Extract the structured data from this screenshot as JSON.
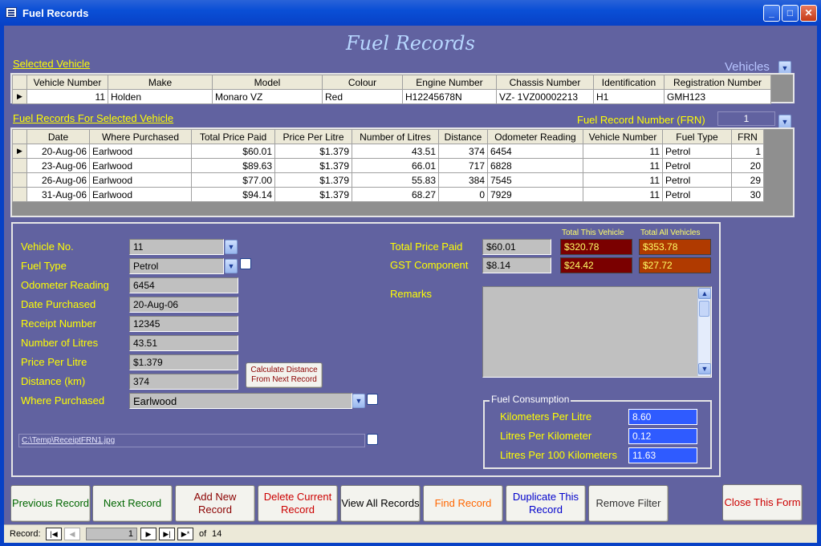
{
  "window": {
    "title": "Fuel Records"
  },
  "form": {
    "heading": "Fuel Records"
  },
  "selected_vehicle": {
    "label": "Selected Vehicle",
    "vehicles_label": "Vehicles",
    "columns": [
      "Vehicle Number",
      "Make",
      "Model",
      "Colour",
      "Engine Number",
      "Chassis Number",
      "Identification",
      "Registration Number"
    ],
    "row": [
      "11",
      "Holden",
      "Monaro VZ",
      "Red",
      "H12245678N",
      "VZ- 1VZ00002213",
      "H1",
      "GMH123"
    ]
  },
  "fuel_records": {
    "label": "Fuel Records For Selected Vehicle",
    "frn_label": "Fuel Record Number (FRN)",
    "frn_value": "1",
    "columns": [
      "Date",
      "Where Purchased",
      "Total Price Paid",
      "Price Per Litre",
      "Number of Litres",
      "Distance",
      "Odometer Reading",
      "Vehicle Number",
      "Fuel Type",
      "FRN"
    ],
    "rows": [
      [
        "20-Aug-06",
        "Earlwood",
        "$60.01",
        "$1.379",
        "43.51",
        "374",
        "6454",
        "11",
        "Petrol",
        "1"
      ],
      [
        "23-Aug-06",
        "Earlwood",
        "$89.63",
        "$1.379",
        "66.01",
        "717",
        "6828",
        "11",
        "Petrol",
        "20"
      ],
      [
        "26-Aug-06",
        "Earlwood",
        "$77.00",
        "$1.379",
        "55.83",
        "384",
        "7545",
        "11",
        "Petrol",
        "29"
      ],
      [
        "31-Aug-06",
        "Earlwood",
        "$94.14",
        "$1.379",
        "68.27",
        "0",
        "7929",
        "11",
        "Petrol",
        "30"
      ]
    ]
  },
  "detail": {
    "vehicle_no_label": "Vehicle No.",
    "vehicle_no": "11",
    "fuel_type_label": "Fuel Type",
    "fuel_type": "Petrol",
    "odometer_label": "Odometer Reading",
    "odometer": "6454",
    "date_label": "Date Purchased",
    "date": "20-Aug-06",
    "receipt_label": "Receipt Number",
    "receipt": "12345",
    "litres_label": "Number of Litres",
    "litres": "43.51",
    "ppl_label": "Price Per Litre",
    "ppl": "$1.379",
    "distance_label": "Distance (km)",
    "distance": "374",
    "where_label": "Where Purchased",
    "where": "Earlwood",
    "calc_button": "Calculate Distance From Next Record",
    "receipt_path": "C:\\Temp\\ReceiptFRN1.jpg",
    "total_price_label": "Total Price Paid",
    "total_price": "$60.01",
    "gst_label": "GST Component",
    "gst": "$8.14",
    "total_this_vehicle_label": "Total This Vehicle",
    "total_all_vehicles_label": "Total All Vehicles",
    "total_this_vehicle_price": "$320.78",
    "total_all_vehicles_price": "$353.78",
    "total_this_vehicle_gst": "$24.42",
    "total_all_vehicles_gst": "$27.72",
    "remarks_label": "Remarks",
    "remarks": ""
  },
  "consumption": {
    "legend": "Fuel Consumption",
    "kpl_label": "Kilometers Per Litre",
    "kpl": "8.60",
    "lpk_label": "Litres Per Kilometer",
    "lpk": "0.12",
    "l100_label": "Litres Per 100 Kilometers",
    "l100": "11.63"
  },
  "buttons": {
    "previous": "Previous Record",
    "next": "Next Record",
    "add": "Add New Record",
    "delete": "Delete Current Record",
    "view_all": "View All Records",
    "find": "Find Record",
    "duplicate": "Duplicate This Record",
    "remove_filter": "Remove Filter",
    "close": "Close This Form"
  },
  "colors": {
    "previous": "#006600",
    "next": "#006600",
    "add": "#8b0000",
    "delete": "#cc0000",
    "view_all": "#000000",
    "find": "#ff6600",
    "duplicate": "#0000cc",
    "remove_filter": "#333333",
    "close": "#cc0000"
  },
  "navigation": {
    "record_label": "Record:",
    "current": "1",
    "of_label": "of",
    "total": "14"
  }
}
